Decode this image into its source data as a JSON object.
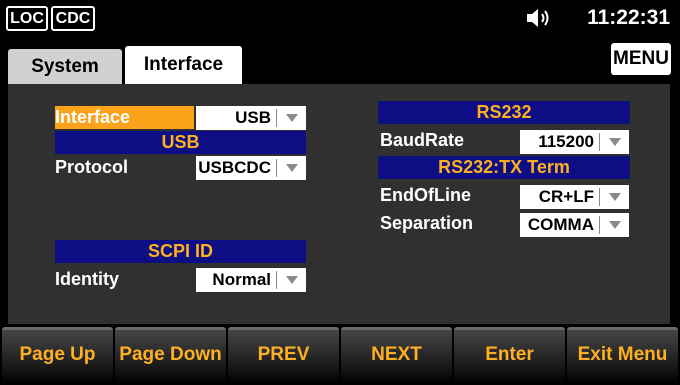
{
  "status_bar": {
    "loc": "LOC",
    "cdc": "CDC",
    "time": "11:22:31"
  },
  "tabs": [
    {
      "label": "System",
      "selected": false
    },
    {
      "label": "Interface",
      "selected": true
    }
  ],
  "menu_label": "MENU",
  "left": {
    "interface_label": "Interface",
    "interface_value": "USB",
    "usb_header": "USB",
    "protocol_label": "Protocol",
    "protocol_value": "USBCDC",
    "scpi_header": "SCPI ID",
    "identity_label": "Identity",
    "identity_value": "Normal"
  },
  "right": {
    "rs232_header": "RS232",
    "baudrate_label": "BaudRate",
    "baudrate_value": "115200",
    "txterm_header": "RS232:TX Term",
    "eol_label": "EndOfLine",
    "eol_value": "CR+LF",
    "separation_label": "Separation",
    "separation_value": "COMMA"
  },
  "softkeys": [
    "Page Up",
    "Page Down",
    "PREV",
    "NEXT",
    "Enter",
    "Exit Menu"
  ],
  "colors": {
    "accent": "#ffb020",
    "header_bg": "#0d0d84",
    "active_bg": "#f9a21a",
    "panel_bg": "#303030"
  },
  "icons": {
    "speaker": "speaker-icon"
  }
}
